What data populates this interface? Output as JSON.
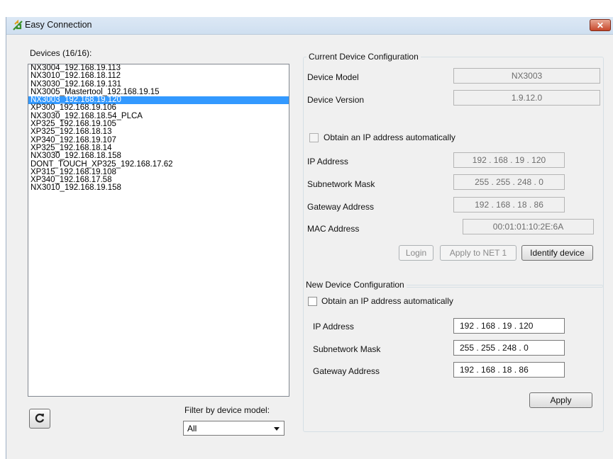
{
  "window": {
    "title": "Easy Connection",
    "close_glyph": "✕"
  },
  "devices": {
    "header": "Devices (16/16):",
    "items": [
      "NX3004_192.168.19.113",
      "NX3010_192.168.18.112",
      "NX3030_192.168.19.131",
      "NX3005_Mastertool_192.168.19.15",
      "NX3003_192.168.19.120",
      "XP300_192.168.19.106",
      "NX3030_192.168.18.54_PLCA",
      "XP325_192.168.19.105",
      "XP325_192.168.18.13",
      "XP340_192.168.19.107",
      "XP325_192.168.18.14",
      "NX3030_192.168.18.158",
      "DONT_TOUCH_XP325_192.168.17.62",
      "XP315_192.168.19.108",
      "XP340_192.168.17.58",
      "NX3010_192.168.19.158"
    ],
    "selected_index": 4
  },
  "filter": {
    "label": "Filter by device model:",
    "value": "All"
  },
  "current": {
    "title": "Current Device Configuration",
    "device_model_label": "Device Model",
    "device_model_value": "NX3003",
    "device_version_label": "Device Version",
    "device_version_value": "1.9.12.0",
    "obtain_label": "Obtain an IP address automatically",
    "ip_label": "IP Address",
    "ip_value": "192 . 168 . 19 . 120",
    "mask_label": "Subnetwork Mask",
    "mask_value": "255 . 255 . 248 .  0",
    "gateway_label": "Gateway Address",
    "gateway_value": "192 . 168 . 18 .  86",
    "mac_label": "MAC Address",
    "mac_value": "00:01:01:10:2E:6A",
    "login_label": "Login",
    "apply_net_label": "Apply to NET 1",
    "identify_label": "Identify device"
  },
  "new": {
    "title": "New Device Configuration",
    "obtain_label": "Obtain an IP address automatically",
    "ip_label": "IP Address",
    "ip_value": "192 . 168 . 19 . 120",
    "mask_label": "Subnetwork Mask",
    "mask_value": "255 . 255 . 248 .  0",
    "gateway_label": "Gateway Address",
    "gateway_value": "192 . 168 . 18 .  86",
    "apply_label": "Apply"
  },
  "colors": {
    "selection": "#3399ff",
    "close_button": "#c7472b",
    "window_bg": "#f0f0f0"
  },
  "icons": {
    "app": "app-arrows-icon",
    "refresh": "refresh-icon",
    "dropdown": "chevron-down-icon"
  }
}
